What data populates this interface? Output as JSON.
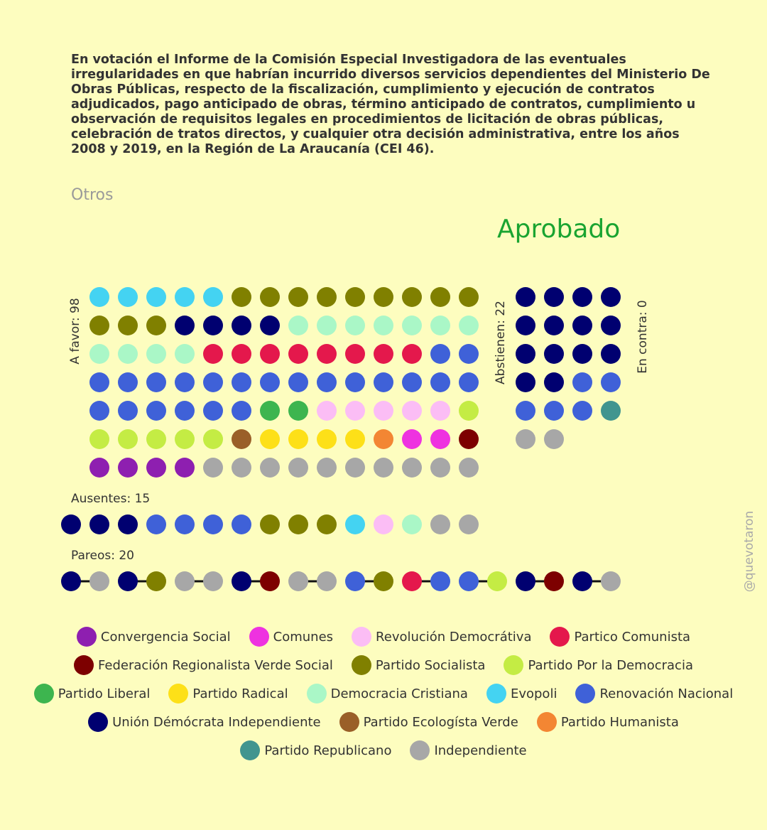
{
  "title": "En votación el Informe de la Comisión Especial Investigadora de las eventuales irregularidades en que habrían incurrido diversos servicios dependientes del Ministerio De Obras Públicas, respecto de la fiscalización, cumplimiento y ejecución de contratos adjudicados, pago anticipado de obras, término anticipado de contratos, cumplimiento u observación de requisitos legales en procedimientos de licitación de obras públicas, celebración de tratos directos, y cualquier otra decisión administrativa, entre los años 2008 y 2019, en la Región de La Araucanía (CEI 46).",
  "category": "Otros",
  "result": "Aprobado",
  "labels": {
    "a_favor": "A favor: 98",
    "abstienen": "Abstienen: 22",
    "en_contra": "En contra: 0",
    "ausentes": "Ausentes: 15",
    "pareos": "Pareos: 20"
  },
  "watermark": "@quevotaron",
  "parties": {
    "CS": {
      "name": "Convergencia Social",
      "color": "#8e1fb0"
    },
    "CO": {
      "name": "Comunes",
      "color": "#ee32e0"
    },
    "RD": {
      "name": "Revolución Democrátiva",
      "color": "#fbbdf5"
    },
    "PC": {
      "name": "Partico Comunista",
      "color": "#e4184c"
    },
    "FRVS": {
      "name": "Federación Regionalista Verde Social",
      "color": "#7d0000"
    },
    "PS": {
      "name": "Partido Socialista",
      "color": "#808000"
    },
    "PPD": {
      "name": "Partido Por la Democracia",
      "color": "#c4ec44"
    },
    "PL": {
      "name": "Partido Liberal",
      "color": "#3db54f"
    },
    "PR": {
      "name": "Partido Radical",
      "color": "#fde018"
    },
    "DC": {
      "name": "Democracia Cristiana",
      "color": "#aaf7c7"
    },
    "EV": {
      "name": "Evopoli",
      "color": "#44d3f2"
    },
    "RN": {
      "name": "Renovación Nacional",
      "color": "#3f61d8"
    },
    "UDI": {
      "name": "Unión Démócrata Independiente",
      "color": "#000070"
    },
    "PEV": {
      "name": "Partido Ecologísta Verde",
      "color": "#9a5f28"
    },
    "PH": {
      "name": "Partido Humanista",
      "color": "#f38633"
    },
    "REP": {
      "name": "Partido Republicano",
      "color": "#41958f"
    },
    "IND": {
      "name": "Independiente",
      "color": "#a7a7a7"
    }
  },
  "legend_rows": [
    [
      "CS",
      "CO",
      "RD",
      "PC"
    ],
    [
      "FRVS",
      "PS",
      "PPD"
    ],
    [
      "PL",
      "PR",
      "DC",
      "EV",
      "RN"
    ],
    [
      "UDI",
      "PEV",
      "PH"
    ],
    [
      "REP",
      "IND"
    ]
  ],
  "votes": {
    "a_favor": [
      [
        "EV",
        "EV",
        "EV",
        "EV",
        "EV",
        "PS",
        "PS",
        "PS",
        "PS",
        "PS",
        "PS",
        "PS",
        "PS",
        "PS"
      ],
      [
        "PS",
        "PS",
        "PS",
        "UDI",
        "UDI",
        "UDI",
        "UDI",
        "DC",
        "DC",
        "DC",
        "DC",
        "DC",
        "DC",
        "DC"
      ],
      [
        "DC",
        "DC",
        "DC",
        "DC",
        "PC",
        "PC",
        "PC",
        "PC",
        "PC",
        "PC",
        "PC",
        "PC",
        "RN",
        "RN"
      ],
      [
        "RN",
        "RN",
        "RN",
        "RN",
        "RN",
        "RN",
        "RN",
        "RN",
        "RN",
        "RN",
        "RN",
        "RN",
        "RN",
        "RN"
      ],
      [
        "RN",
        "RN",
        "RN",
        "RN",
        "RN",
        "RN",
        "PL",
        "PL",
        "RD",
        "RD",
        "RD",
        "RD",
        "RD",
        "PPD"
      ],
      [
        "PPD",
        "PPD",
        "PPD",
        "PPD",
        "PPD",
        "PEV",
        "PR",
        "PR",
        "PR",
        "PR",
        "PH",
        "CO",
        "CO",
        "FRVS"
      ],
      [
        "CS",
        "CS",
        "CS",
        "CS",
        "IND",
        "IND",
        "IND",
        "IND",
        "IND",
        "IND",
        "IND",
        "IND",
        "IND",
        "IND"
      ]
    ],
    "abstienen": [
      [
        "UDI",
        "UDI",
        "UDI",
        "UDI"
      ],
      [
        "UDI",
        "UDI",
        "UDI",
        "UDI"
      ],
      [
        "UDI",
        "UDI",
        "UDI",
        "UDI"
      ],
      [
        "UDI",
        "UDI",
        "RN",
        "RN"
      ],
      [
        "RN",
        "RN",
        "RN",
        "REP"
      ],
      [
        "IND",
        "IND"
      ]
    ],
    "en_contra": [],
    "ausentes": [
      "UDI",
      "UDI",
      "UDI",
      "RN",
      "RN",
      "RN",
      "RN",
      "PS",
      "PS",
      "PS",
      "EV",
      "RD",
      "DC",
      "IND",
      "IND"
    ],
    "pareos": [
      [
        "UDI",
        "IND"
      ],
      [
        "UDI",
        "PS"
      ],
      [
        "IND",
        "IND"
      ],
      [
        "UDI",
        "FRVS"
      ],
      [
        "IND",
        "IND"
      ],
      [
        "RN",
        "PS"
      ],
      [
        "PC",
        "RN"
      ],
      [
        "RN",
        "PPD"
      ],
      [
        "UDI",
        "FRVS"
      ],
      [
        "UDI",
        "IND"
      ]
    ]
  }
}
